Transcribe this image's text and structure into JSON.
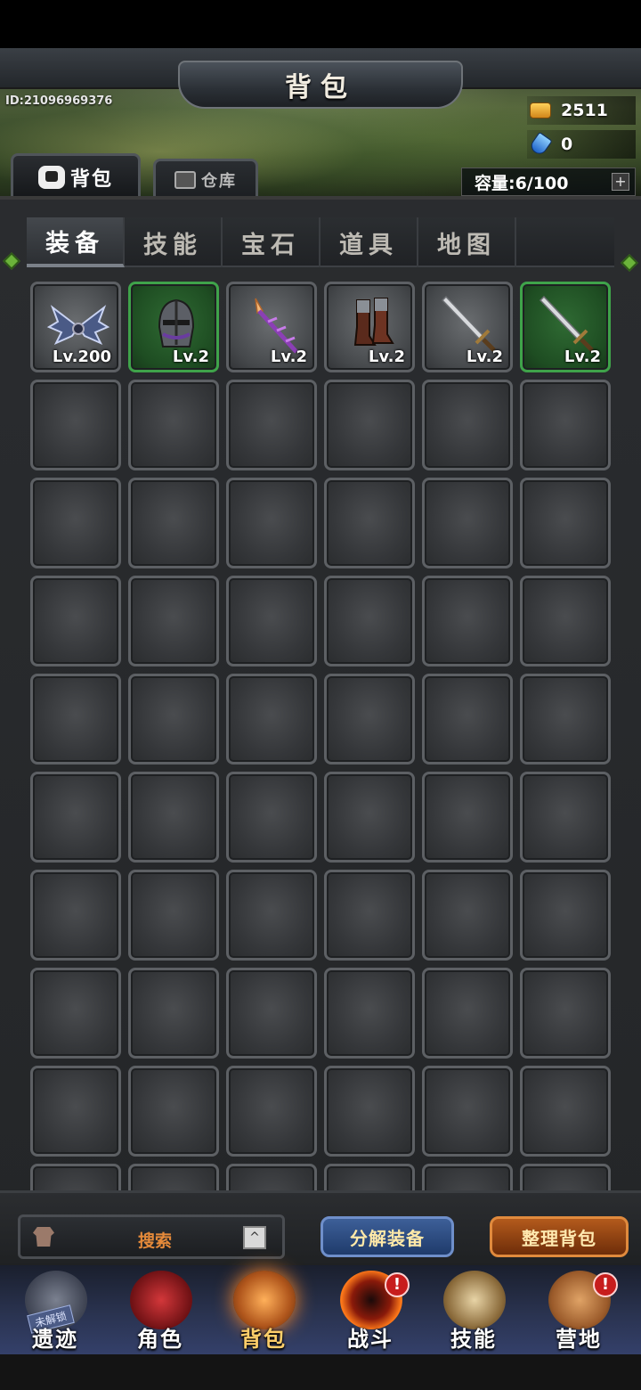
{
  "header": {
    "title": "背包",
    "player_id": "ID:21096969376",
    "gold": "2511",
    "gems": "0",
    "capacity": "容量:6/100",
    "plus": "+"
  },
  "top_tabs": {
    "bag": "背包",
    "warehouse": "仓库"
  },
  "category_tabs": [
    "装备",
    "技能",
    "宝石",
    "道具",
    "地图"
  ],
  "items": [
    {
      "name": "wings",
      "level": "Lv.200",
      "frame": "gray"
    },
    {
      "name": "helmet",
      "level": "Lv.2",
      "frame": "green"
    },
    {
      "name": "staff",
      "level": "Lv.2",
      "frame": "gray"
    },
    {
      "name": "boots",
      "level": "Lv.2",
      "frame": "gray"
    },
    {
      "name": "sword",
      "level": "Lv.2",
      "frame": "gray"
    },
    {
      "name": "sword",
      "level": "Lv.2",
      "frame": "green"
    }
  ],
  "bottom": {
    "search_label": "搜索",
    "arrow": "^",
    "decompose": "分解装备",
    "organize": "整理背包"
  },
  "nav": {
    "items": [
      {
        "label": "遗迹",
        "tag": "未解锁",
        "badge": ""
      },
      {
        "label": "角色",
        "badge": ""
      },
      {
        "label": "背包",
        "badge": ""
      },
      {
        "label": "战斗",
        "badge": "!"
      },
      {
        "label": "技能",
        "badge": ""
      },
      {
        "label": "营地",
        "badge": "!"
      }
    ]
  },
  "colors": {
    "accent_gold": "#ffcf6a",
    "rare_green": "#3fa34a",
    "badge_red": "#c71d1d"
  }
}
